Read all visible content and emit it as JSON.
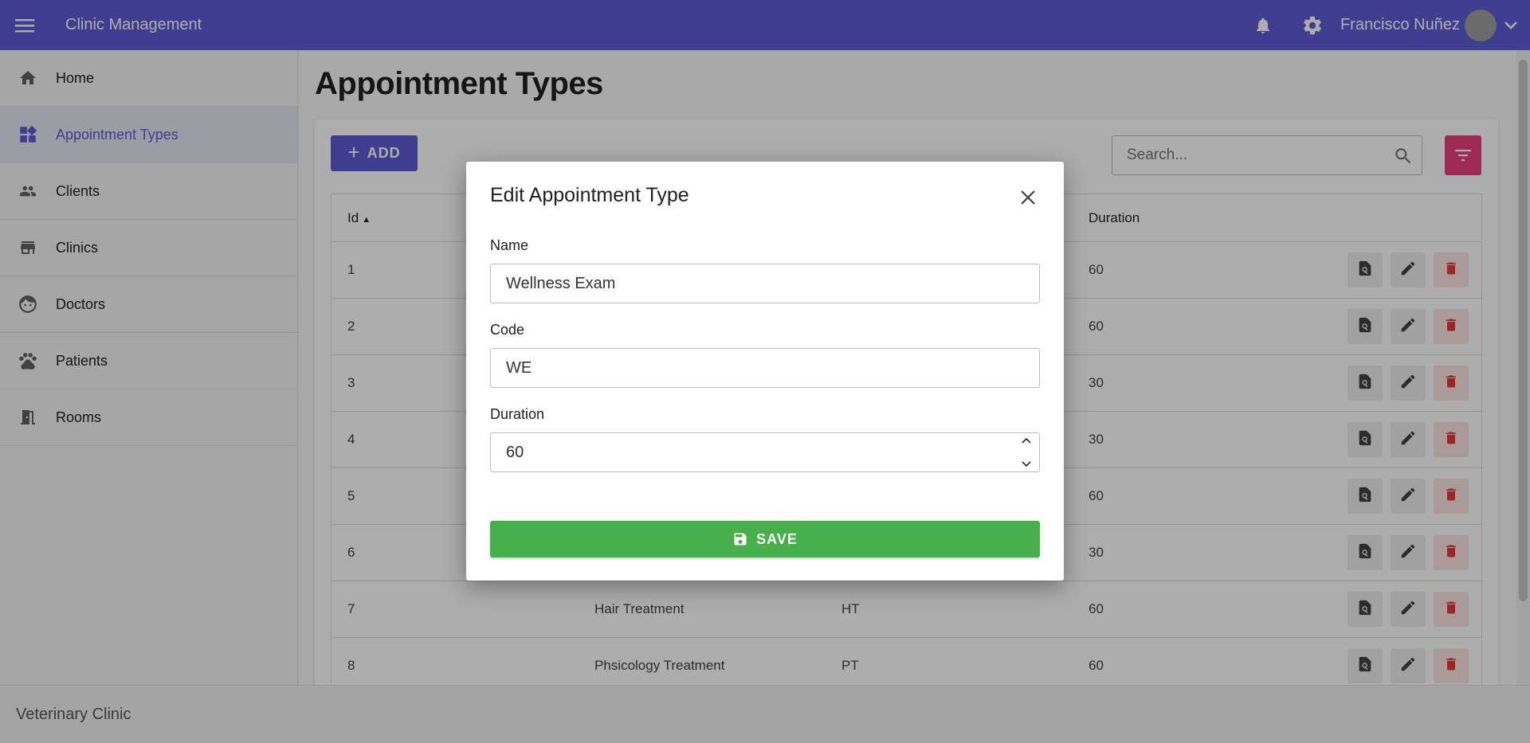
{
  "app": {
    "title": "Clinic Management",
    "user_name": "Francisco Nuñez",
    "footer": "Veterinary Clinic"
  },
  "icons": {
    "menu": "hamburger-menu-icon",
    "notifications": "bell-icon",
    "settings": "gear-icon",
    "user_menu": "chevron-down-icon"
  },
  "sidebar": {
    "items": [
      {
        "label": "Home",
        "icon": "home-icon"
      },
      {
        "label": "Appointment Types",
        "icon": "dashboard-widgets-icon",
        "active": true
      },
      {
        "label": "Clients",
        "icon": "people-icon"
      },
      {
        "label": "Clinics",
        "icon": "store-icon"
      },
      {
        "label": "Doctors",
        "icon": "face-icon"
      },
      {
        "label": "Patients",
        "icon": "paw-icon"
      },
      {
        "label": "Rooms",
        "icon": "door-icon"
      }
    ]
  },
  "page": {
    "title": "Appointment Types",
    "add_label": "ADD",
    "search_placeholder": "Search..."
  },
  "table": {
    "headers": {
      "id": "Id",
      "duration": "Duration"
    },
    "rows": [
      {
        "id": "1",
        "name": "",
        "code": "",
        "duration": "60"
      },
      {
        "id": "2",
        "name": "",
        "code": "",
        "duration": "60"
      },
      {
        "id": "3",
        "name": "",
        "code": "",
        "duration": "30"
      },
      {
        "id": "4",
        "name": "",
        "code": "",
        "duration": "30"
      },
      {
        "id": "5",
        "name": "",
        "code": "",
        "duration": "60"
      },
      {
        "id": "6",
        "name": "",
        "code": "",
        "duration": "30"
      },
      {
        "id": "7",
        "name": "Hair Treatment",
        "code": "HT",
        "duration": "60"
      },
      {
        "id": "8",
        "name": "Phsicology Treatment",
        "code": "PT",
        "duration": "60"
      }
    ]
  },
  "modal": {
    "title": "Edit Appointment Type",
    "name_label": "Name",
    "name_value": "Wellness Exam",
    "code_label": "Code",
    "code_value": "WE",
    "duration_label": "Duration",
    "duration_value": "60",
    "save_label": "SAVE"
  },
  "colors": {
    "primary": "#5c5bd4",
    "danger": "#e63f7c",
    "success": "#47b04b",
    "delete_icon": "#e53935"
  }
}
